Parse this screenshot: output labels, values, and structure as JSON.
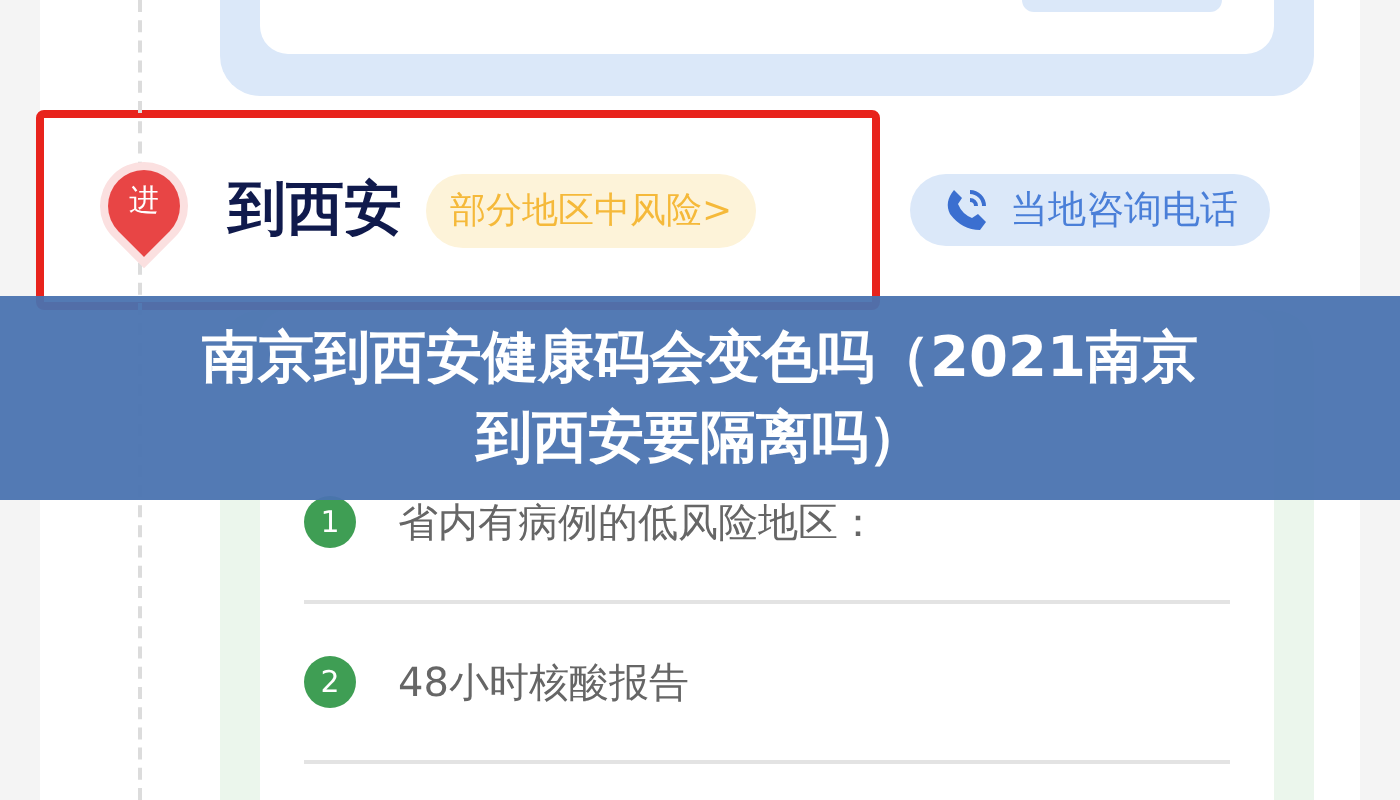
{
  "route": {
    "pin_label": "进",
    "destination": "到西安",
    "risk_badge": "部分地区中风险>",
    "highlighted": true
  },
  "hotline_button": {
    "label": "当地咨询电话"
  },
  "requirements": [
    {
      "number": "1",
      "text": "省内有病例的低风险地区："
    },
    {
      "number": "2",
      "text": "48小时核酸报告"
    }
  ],
  "overlay_title_lines": [
    "南京到西安健康码会变色吗（2021南京",
    "到西安要隔离吗）"
  ]
}
